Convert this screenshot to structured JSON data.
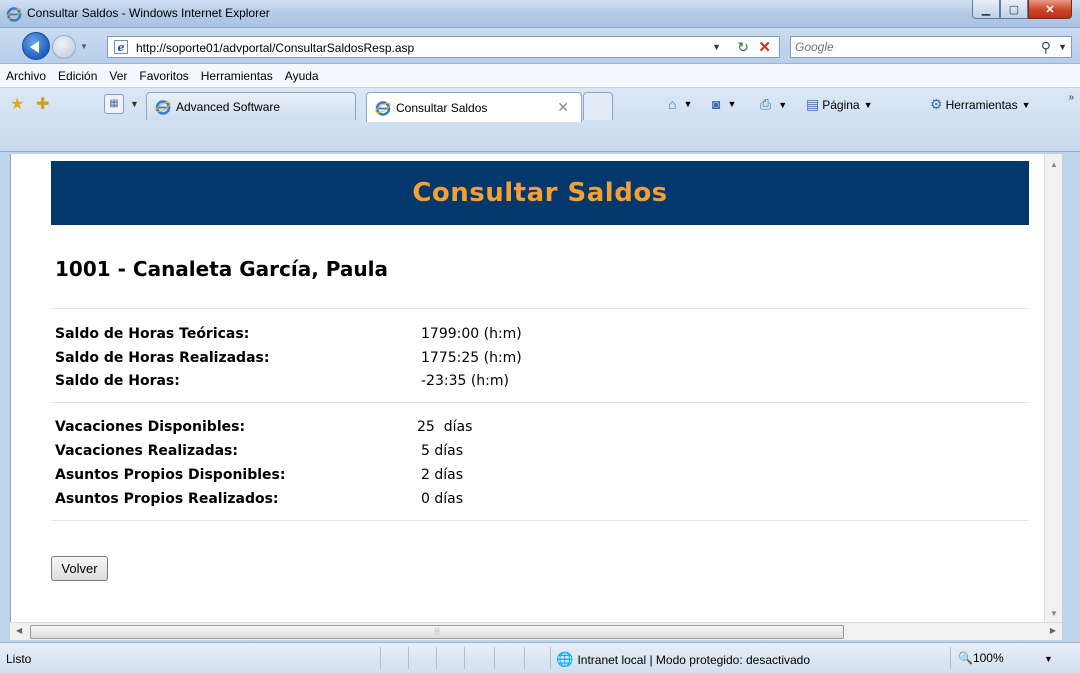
{
  "window": {
    "title": "Consultar Saldos - Windows Internet Explorer"
  },
  "address": {
    "url": "http://soporte01/advportal/ConsultarSaldosResp.asp",
    "search_placeholder": "Google"
  },
  "menu": [
    "Archivo",
    "Edición",
    "Ver",
    "Favoritos",
    "Herramientas",
    "Ayuda"
  ],
  "tabs": [
    {
      "label": "Advanced Software"
    },
    {
      "label": "Consultar Saldos"
    }
  ],
  "commands": {
    "page_label": "Página",
    "tools_label": "Herramientas"
  },
  "page": {
    "banner_title": "Consultar Saldos",
    "employee": "1001 - Canaleta García, Paula",
    "hours": [
      {
        "label": "Saldo de Horas Teóricas:",
        "value": "1799:00 (h:m)"
      },
      {
        "label": "Saldo de Horas Realizadas:",
        "value": "1775:25 (h:m)"
      },
      {
        "label": "Saldo de Horas:",
        "value": "-23:35 (h:m)"
      }
    ],
    "days": [
      {
        "label": "Vacaciones Disponibles:",
        "value": "25  días"
      },
      {
        "label": "Vacaciones Realizadas:",
        "value": "5 días"
      },
      {
        "label": "Asuntos Propios Disponibles:",
        "value": "2 días"
      },
      {
        "label": "Asuntos Propios Realizados:",
        "value": "0 días"
      }
    ],
    "back_button": "Volver"
  },
  "status": {
    "text": "Listo",
    "zone": "Intranet local | Modo protegido: desactivado",
    "zoom": "100%"
  },
  "colors": {
    "banner_bg": "#02386b",
    "banner_text": "#f6a033"
  }
}
